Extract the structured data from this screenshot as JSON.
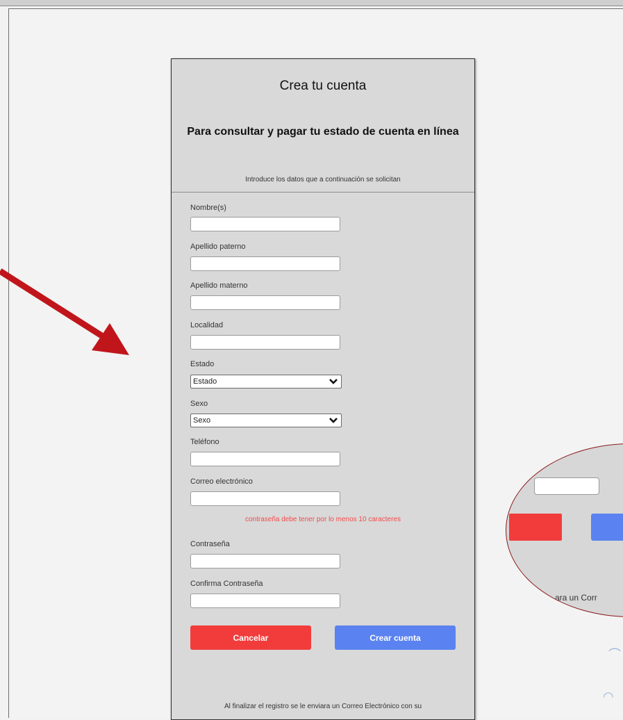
{
  "card": {
    "title": "Crea tu cuenta",
    "subtitle": "Para consultar y pagar tu estado de cuenta en línea",
    "intro": "Introduce los datos que a continuación se solicitan"
  },
  "form": {
    "fields": [
      {
        "label": "Nombre(s)",
        "value": ""
      },
      {
        "label": "Apellido paterno",
        "value": ""
      },
      {
        "label": "Apellido materno",
        "value": ""
      },
      {
        "label": "Localidad",
        "value": ""
      },
      {
        "label": "Teléfono",
        "value": ""
      },
      {
        "label": "Correo electrónico",
        "value": ""
      },
      {
        "label": "Contraseña",
        "value": ""
      },
      {
        "label": "Confirma Contraseña",
        "value": ""
      }
    ],
    "selects": [
      {
        "label": "Estado",
        "selected": "Estado"
      },
      {
        "label": "Sexo",
        "selected": "Sexo"
      }
    ],
    "password_note": "contraseña debe tener por lo menos 10 caracteres",
    "cancel_label": "Cancelar",
    "create_label": "Crear cuenta",
    "footer_note": "Al finalizar el registro se le enviara un Correo Electrónico con su"
  },
  "zoom_callout": {
    "text": "ara un Corr"
  },
  "colors": {
    "card_bg": "#d9d9d9",
    "cancel_button": "#f23c3c",
    "create_button": "#5a82f0",
    "warning_text": "#f24b4b",
    "annotation_arrow": "#c0161b",
    "callout_border": "#8b1a1a"
  },
  "icons": {
    "select_arrow": "chevron-down-icon",
    "annotation": "arrow-icon"
  }
}
